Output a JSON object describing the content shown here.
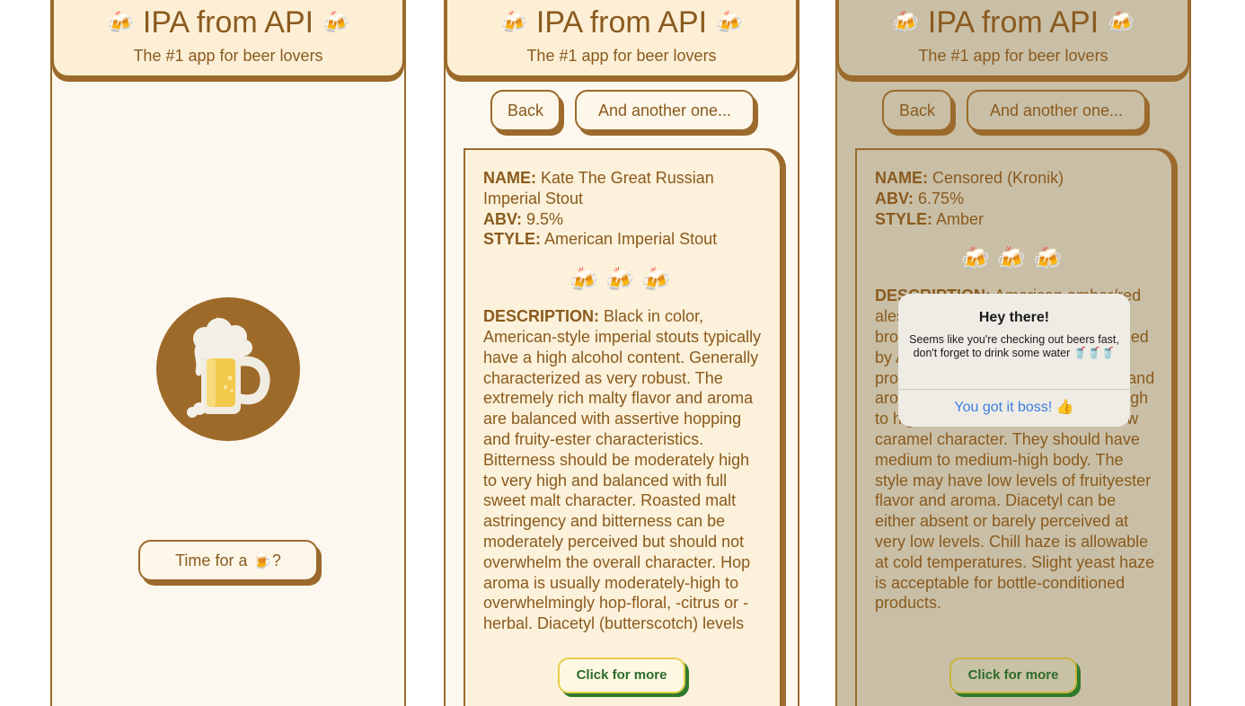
{
  "app": {
    "title": "IPA from API",
    "title_emoji": "🍻",
    "subtitle": "The #1 app for beer lovers"
  },
  "screen1": {
    "logo_icon": "beer-mug-logo",
    "cta_label": "Time for a 🍺?"
  },
  "screen2": {
    "back_label": "Back",
    "another_label": "And another one...",
    "name_label": "NAME:",
    "name_value": "Kate The Great Russian Imperial Stout",
    "abv_label": "ABV:",
    "abv_value": "9.5%",
    "style_label": "STYLE:",
    "style_value": "American Imperial Stout",
    "rating_mugs": "🍻🍻🍻",
    "desc_label": "DESCRIPTION:",
    "desc_value": "Black in color, American-style imperial stouts typically have a high alcohol content. Generally characterized as very robust. The extremely rich malty flavor and aroma are balanced with assertive hopping and fruity-ester characteristics. Bitterness should be moderately high to very high and balanced with full sweet malt character. Roasted malt astringency and bitterness can be moderately perceived but should not overwhelm the overall character. Hop aroma is usually moderately-high to overwhelmingly hop-floral, -citrus or -herbal. Diacetyl (butterscotch) levels",
    "more_label": "Click for more"
  },
  "screen3": {
    "back_label": "Back",
    "another_label": "And another one...",
    "name_label": "NAME:",
    "name_value": "Censored (Kronik)",
    "abv_label": "ABV:",
    "abv_value": "6.75%",
    "style_label": "STYLE:",
    "style_value": "Amber",
    "rating_mugs": "🍻🍻🍻",
    "desc_label": "DESCRIPTION:",
    "desc_value": "American amber/red ales range from light copper to light brown in color. They are characterized by American-variety hops used to produce high hop bitterness, flavor and aroma. Amber ales have medium-high to high maltiness with medium to low caramel character. They should have medium to medium-high body. The style may have low levels of fruityester flavor and aroma. Diacetyl can be either absent or barely perceived at very low levels. Chill haze is allowable at cold temperatures. Slight yeast haze is acceptable for bottle-conditioned products.",
    "more_label": "Click for more",
    "alert": {
      "title": "Hey there!",
      "message": "Seems like you're checking out beers fast, don't forget to drink some water 🥤🥤🥤",
      "button_label": "You got it boss! 👍"
    }
  },
  "colors": {
    "accent_brown": "#9b6a2c",
    "text_brown": "#8a5a1e",
    "header_bg": "#fcefd6",
    "card_bg": "#fcf1da",
    "dim_bg": "#c9bfa6",
    "more_text_green": "#2e6b2a",
    "more_border_yellow": "#e6cf4a",
    "alert_link_blue": "#3b7fe0"
  }
}
